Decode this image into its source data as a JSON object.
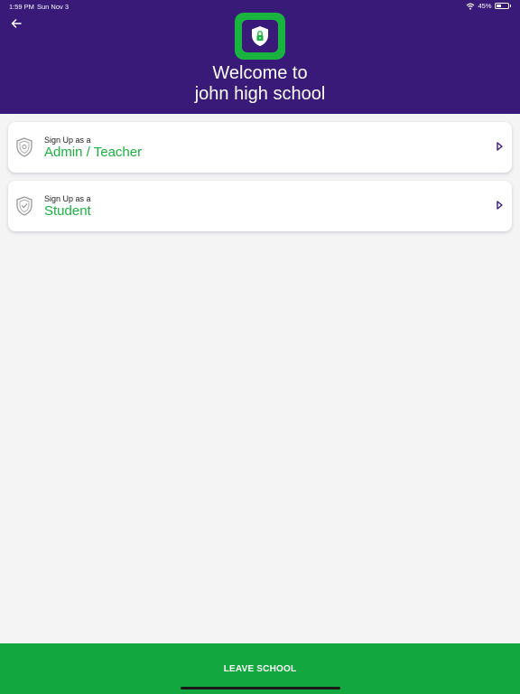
{
  "status_bar": {
    "time": "1:59 PM",
    "date": "Sun Nov 3",
    "battery_percent": "45%",
    "battery_level": 0.45
  },
  "header": {
    "title_line1": "Welcome to",
    "title_line2": "john high school"
  },
  "options": [
    {
      "subtitle": "Sign Up as a",
      "title": "Admin / Teacher"
    },
    {
      "subtitle": "Sign Up as a",
      "title": "Student"
    }
  ],
  "footer": {
    "button_label": "LEAVE SCHOOL"
  },
  "icons": {
    "back": "arrow-left-icon",
    "logo": "shield-lock-icon",
    "option_admin": "shield-gear-icon",
    "option_student": "shield-check-icon",
    "chevron": "chevron-right-icon",
    "wifi": "wifi-icon",
    "battery": "battery-icon"
  },
  "colors": {
    "header_bg": "#3a1a78",
    "accent_green": "#19b340",
    "page_bg": "#f4f4f4",
    "chevron": "#3a1a78"
  }
}
